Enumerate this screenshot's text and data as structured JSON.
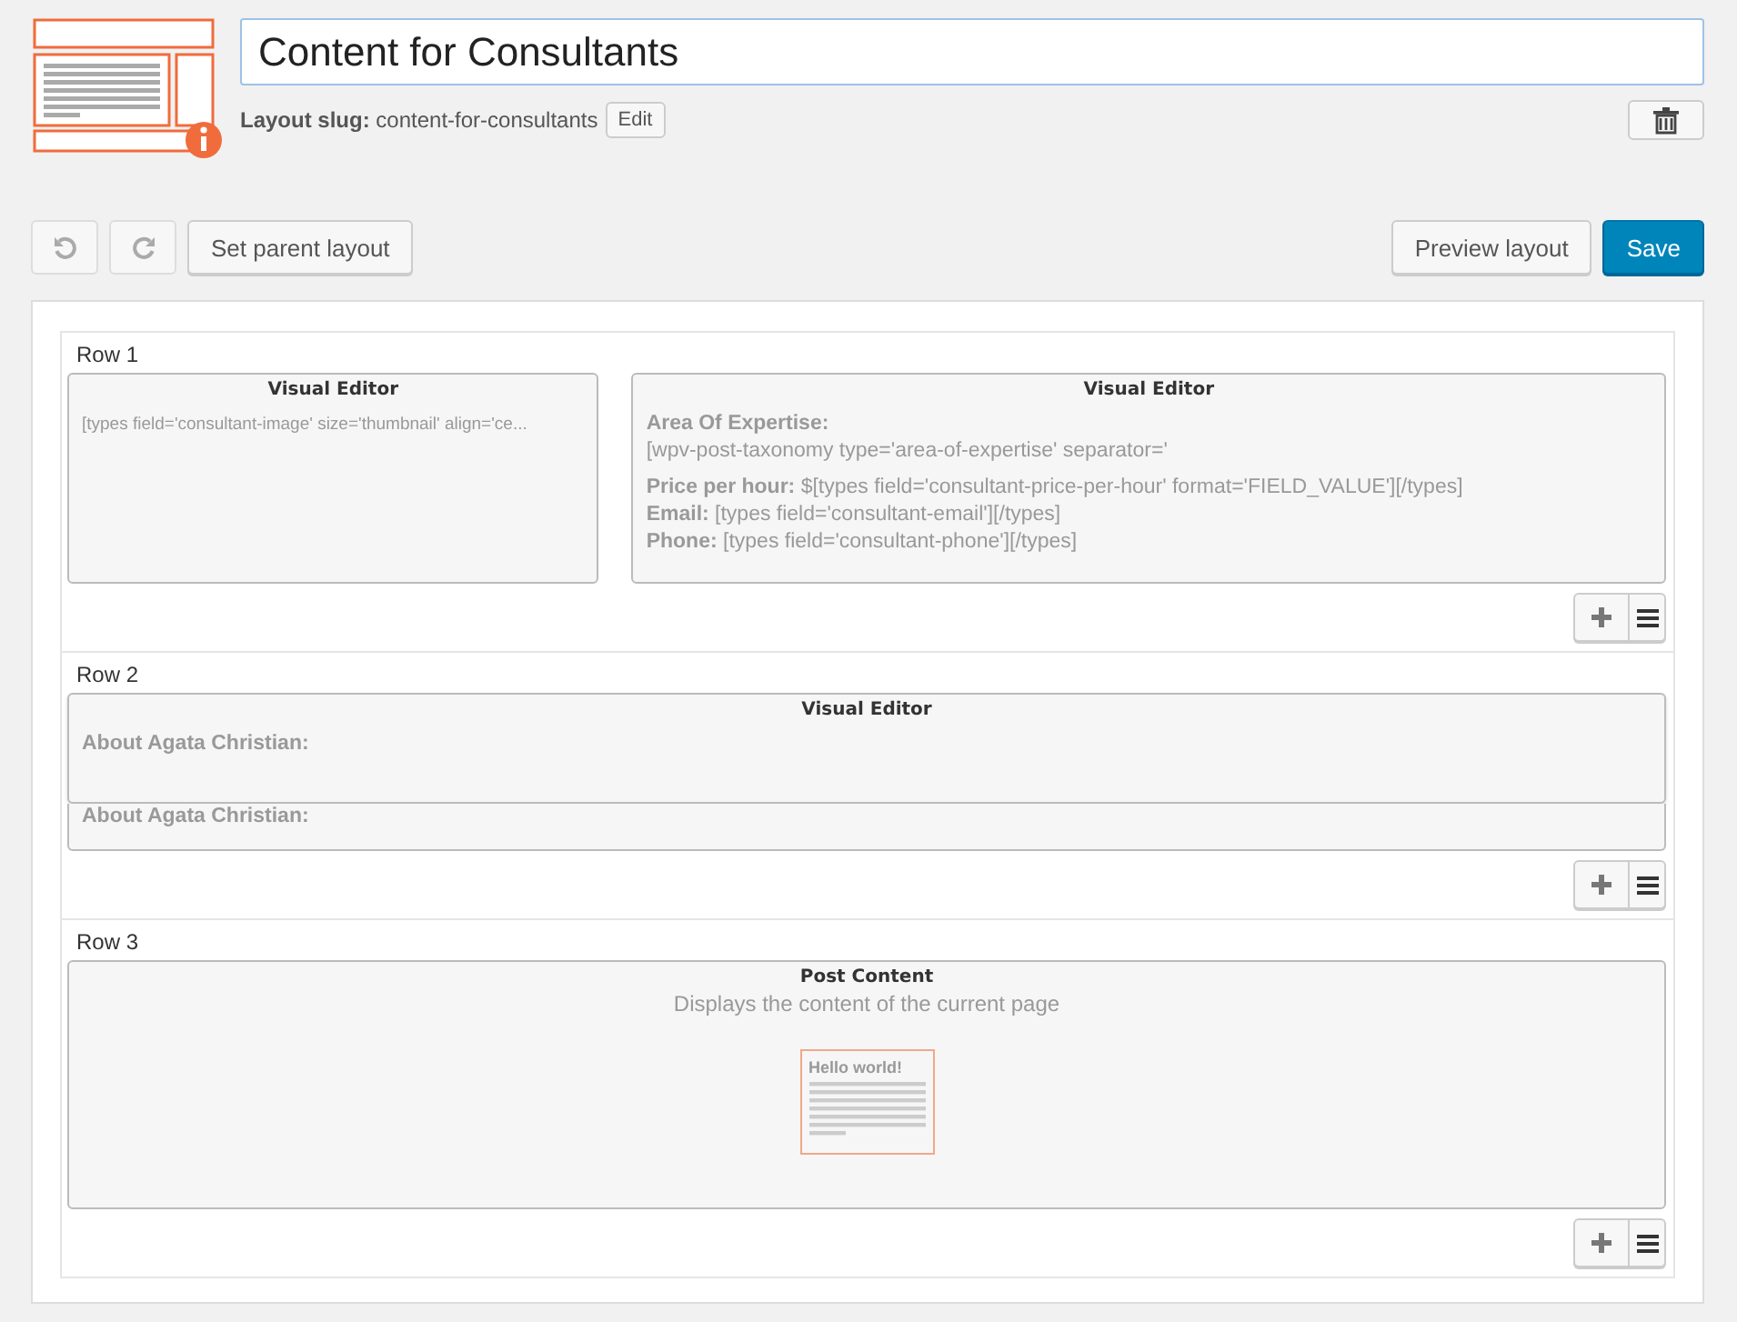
{
  "layout": {
    "title": "Content for Consultants",
    "slug_label": "Layout slug:",
    "slug": "content-for-consultants",
    "edit_button": "Edit"
  },
  "toolbar": {
    "undo_disabled": true,
    "redo_disabled": true,
    "parent_button": "Set parent layout",
    "preview_button": "Preview layout",
    "save_button": "Save"
  },
  "rows": [
    {
      "label": "Row 1",
      "cells": [
        {
          "kind": "visual_editor",
          "title": "Visual Editor",
          "lines": [
            "[types field='consultant-image' size='thumbnail' align='ce..."
          ],
          "small": true
        },
        {
          "kind": "visual_editor",
          "title": "Visual Editor",
          "lines": [
            "**Area Of Expertise:**",
            "[wpv-post-taxonomy type='area-of-expertise' separator='",
            "**Price per hour:** $[types field='consultant-price-per-hour' format='FIELD_VALUE'][/types]",
            "**Email:** [types field='consultant-email'][/types]",
            "**Phone:** [types field='consultant-phone'][/types]"
          ],
          "small": false
        }
      ]
    },
    {
      "label": "Row 2",
      "cells": [
        {
          "kind": "dragged_editor",
          "title": "Visual Editor",
          "lines": [
            "**About Agata Christian:**"
          ],
          "underlay": "**About Agata Christian:**",
          "small": false
        }
      ]
    },
    {
      "label": "Row 3",
      "cells": [
        {
          "kind": "post_content",
          "title": "Post Content",
          "description": "Displays the content of the current page",
          "preview_title": "Hello world!"
        }
      ]
    }
  ]
}
